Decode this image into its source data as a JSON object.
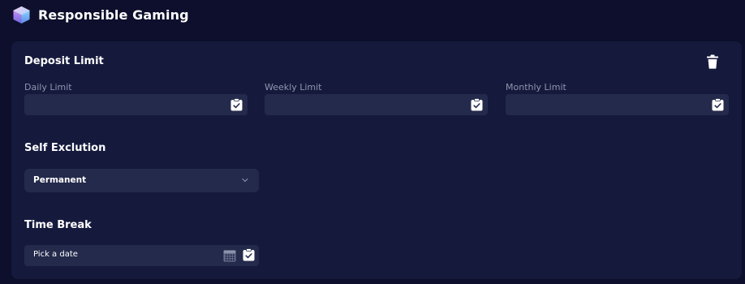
{
  "header": {
    "title": "Responsible Gaming",
    "logo_icon": "cube-logo-icon"
  },
  "deposit_limit": {
    "title": "Deposit Limit",
    "delete_icon": "trash-icon",
    "fields": [
      {
        "label": "Daily Limit",
        "value": "",
        "icon": "clipboard-check-icon"
      },
      {
        "label": "Weekly Limit",
        "value": "",
        "icon": "clipboard-check-icon"
      },
      {
        "label": "Monthly Limit",
        "value": "",
        "icon": "clipboard-check-icon"
      }
    ]
  },
  "self_exclusion": {
    "title": "Self Exclution",
    "selected": "Permanent",
    "icon": "chevron-down-icon"
  },
  "time_break": {
    "title": "Time Break",
    "placeholder": "Pick a date",
    "calendar_icon": "calendar-icon",
    "confirm_icon": "clipboard-check-icon"
  },
  "colors": {
    "background": "#0d0f2c",
    "card": "#151a3d",
    "input": "#242a4b",
    "label": "#8f94ae",
    "text": "#ffffff"
  }
}
